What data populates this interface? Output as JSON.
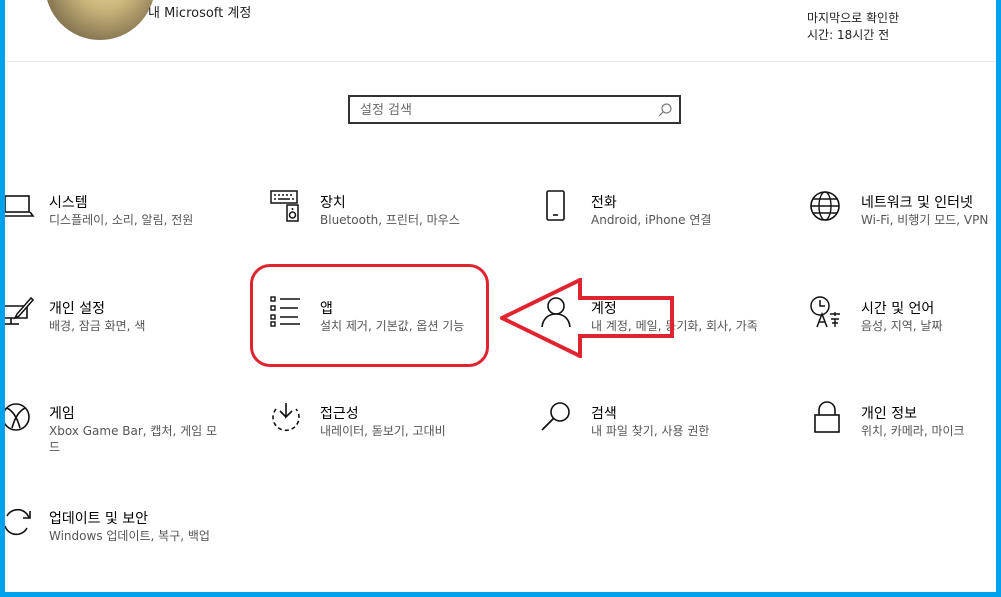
{
  "account": {
    "label": "내 Microsoft 계정",
    "last_check_line1": "마지막으로 확인한",
    "last_check_line2": "시간: 18시간 전"
  },
  "search": {
    "placeholder": "설정 검색"
  },
  "tiles": [
    {
      "title": "시스템",
      "desc": "디스플레이, 소리, 알림, 전원",
      "icon": "laptop-icon"
    },
    {
      "title": "장치",
      "desc": "Bluetooth, 프린터, 마우스",
      "icon": "devices-icon"
    },
    {
      "title": "전화",
      "desc": "Android, iPhone 연결",
      "icon": "phone-icon"
    },
    {
      "title": "네트워크 및 인터넷",
      "desc": "Wi-Fi, 비행기 모드, VPN",
      "icon": "globe-icon"
    },
    {
      "title": "개인 설정",
      "desc": "배경, 잠금 화면, 색",
      "icon": "personalization-icon"
    },
    {
      "title": "앱",
      "desc": "설치 제거, 기본값, 옵션 기능",
      "icon": "apps-list-icon"
    },
    {
      "title": "계정",
      "desc": "내 계정, 메일, 동기화, 회사, 가족",
      "icon": "person-icon"
    },
    {
      "title": "시간 및 언어",
      "desc": "음성, 지역, 날짜",
      "icon": "time-language-icon"
    },
    {
      "title": "게임",
      "desc": "Xbox Game Bar, 캡처, 게임 모드",
      "icon": "xbox-icon"
    },
    {
      "title": "접근성",
      "desc": "내레이터, 돋보기, 고대비",
      "icon": "ease-of-access-icon"
    },
    {
      "title": "검색",
      "desc": "내 파일 찾기, 사용 권한",
      "icon": "search-icon"
    },
    {
      "title": "개인 정보",
      "desc": "위치, 카메라, 마이크",
      "icon": "lock-icon"
    },
    {
      "title": "업데이트 및 보안",
      "desc": "Windows 업데이트, 복구, 백업",
      "icon": "update-icon"
    }
  ],
  "annotation": {
    "highlighted_tile": "앱",
    "color": "#e0242f"
  },
  "colors": {
    "frame": "#00a2ed",
    "accent": "#e0242f"
  }
}
